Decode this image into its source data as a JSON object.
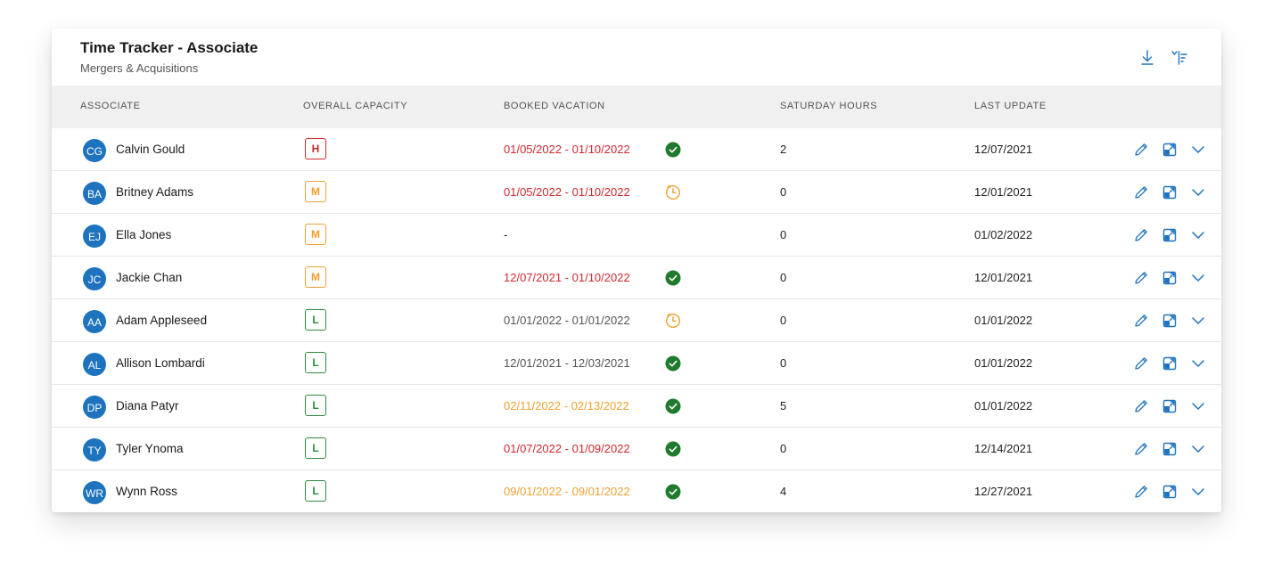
{
  "header": {
    "title": "Time Tracker - Associate",
    "subtitle": "Mergers & Acquisitions",
    "download_icon": "download-icon",
    "sort_icon": "sort-filter-icon"
  },
  "columns": {
    "associate": "ASSOCIATE",
    "capacity": "OVERALL CAPACITY",
    "vacation": "BOOKED VACATION",
    "saturday": "SATURDAY HOURS",
    "updated": "LAST UPDATE"
  },
  "colors": {
    "accent": "#1e73be",
    "high": "#d0282e",
    "medium": "#f0a030",
    "low": "#2e8b3e",
    "neutral": "#555555",
    "approved": "#1f7a2e",
    "pending": "#f0a030"
  },
  "rows": [
    {
      "initials": "CG",
      "name": "Calvin Gould",
      "capacity": "H",
      "vacation": "01/05/2022 - 01/10/2022",
      "vacation_tone": "high",
      "vacation_status": "approved",
      "saturday": "2",
      "updated": "12/07/2021"
    },
    {
      "initials": "BA",
      "name": "Britney Adams",
      "capacity": "M",
      "vacation": "01/05/2022 - 01/10/2022",
      "vacation_tone": "high",
      "vacation_status": "pending",
      "saturday": "0",
      "updated": "12/01/2021"
    },
    {
      "initials": "EJ",
      "name": "Ella Jones",
      "capacity": "M",
      "vacation": "-",
      "vacation_tone": "plain",
      "vacation_status": "none",
      "saturday": "0",
      "updated": "01/02/2022"
    },
    {
      "initials": "JC",
      "name": "Jackie Chan",
      "capacity": "M",
      "vacation": "12/07/2021 - 01/10/2022",
      "vacation_tone": "high",
      "vacation_status": "approved",
      "saturday": "0",
      "updated": "12/01/2021"
    },
    {
      "initials": "AA",
      "name": "Adam Appleseed",
      "capacity": "L",
      "vacation": "01/01/2022 - 01/01/2022",
      "vacation_tone": "neutral",
      "vacation_status": "pending",
      "saturday": "0",
      "updated": "01/01/2022"
    },
    {
      "initials": "AL",
      "name": "Allison Lombardi",
      "capacity": "L",
      "vacation": "12/01/2021 - 12/03/2021",
      "vacation_tone": "neutral",
      "vacation_status": "approved",
      "saturday": "0",
      "updated": "01/01/2022"
    },
    {
      "initials": "DP",
      "name": "Diana Patyr",
      "capacity": "L",
      "vacation": "02/11/2022 - 02/13/2022",
      "vacation_tone": "medium",
      "vacation_status": "approved",
      "saturday": "5",
      "updated": "01/01/2022"
    },
    {
      "initials": "TY",
      "name": "Tyler Ynoma",
      "capacity": "L",
      "vacation": "01/07/2022 - 01/09/2022",
      "vacation_tone": "high",
      "vacation_status": "approved",
      "saturday": "0",
      "updated": "12/14/2021"
    },
    {
      "initials": "WR",
      "name": "Wynn Ross",
      "capacity": "L",
      "vacation": "09/01/2022 - 09/01/2022",
      "vacation_tone": "medium",
      "vacation_status": "approved",
      "saturday": "4",
      "updated": "12/27/2021"
    }
  ],
  "row_actions": {
    "edit_icon": "pencil-icon",
    "open_icon": "open-window-icon",
    "expand_icon": "chevron-down-icon"
  }
}
